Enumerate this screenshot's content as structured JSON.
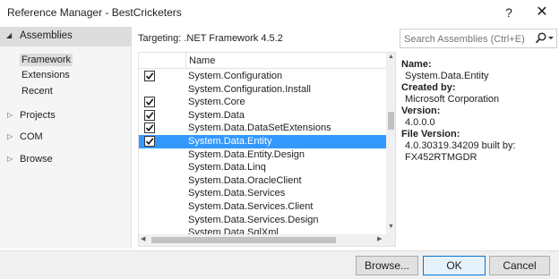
{
  "window": {
    "title": "Reference Manager - BestCricketers",
    "help_label": "?",
    "close_label": "✕"
  },
  "sidebar": {
    "assemblies_label": "Assemblies",
    "sub_items": [
      {
        "label": "Framework",
        "selected": true
      },
      {
        "label": "Extensions",
        "selected": false
      },
      {
        "label": "Recent",
        "selected": false
      }
    ],
    "items": [
      {
        "label": "Projects"
      },
      {
        "label": "COM"
      },
      {
        "label": "Browse"
      }
    ]
  },
  "targeting": "Targeting: .NET Framework 4.5.2",
  "search": {
    "placeholder": "Search Assemblies (Ctrl+E)",
    "icon": "search-icon"
  },
  "list": {
    "header_name": "Name",
    "rows": [
      {
        "name": "System.Configuration",
        "checked": true,
        "selected": false
      },
      {
        "name": "System.Configuration.Install",
        "checked": false,
        "selected": false
      },
      {
        "name": "System.Core",
        "checked": true,
        "selected": false
      },
      {
        "name": "System.Data",
        "checked": true,
        "selected": false
      },
      {
        "name": "System.Data.DataSetExtensions",
        "checked": true,
        "selected": false
      },
      {
        "name": "System.Data.Entity",
        "checked": true,
        "selected": true
      },
      {
        "name": "System.Data.Entity.Design",
        "checked": false,
        "selected": false
      },
      {
        "name": "System.Data.Linq",
        "checked": false,
        "selected": false
      },
      {
        "name": "System.Data.OracleClient",
        "checked": false,
        "selected": false
      },
      {
        "name": "System.Data.Services",
        "checked": false,
        "selected": false
      },
      {
        "name": "System.Data.Services.Client",
        "checked": false,
        "selected": false
      },
      {
        "name": "System.Data.Services.Design",
        "checked": false,
        "selected": false
      },
      {
        "name": "System.Data.SqlXml",
        "checked": false,
        "selected": false
      }
    ]
  },
  "details": {
    "name_label": "Name:",
    "name_value": "System.Data.Entity",
    "created_label": "Created by:",
    "created_value": "Microsoft Corporation",
    "version_label": "Version:",
    "version_value": "4.0.0.0",
    "file_version_label": "File Version:",
    "file_version_value_1": "4.0.30319.34209 built by:",
    "file_version_value_2": "FX452RTMGDR"
  },
  "buttons": {
    "browse": "Browse...",
    "ok": "OK",
    "cancel": "Cancel"
  },
  "colors": {
    "selection": "#3399ff",
    "nav_header": "#dcdcdc",
    "primary_border": "#0078d7"
  }
}
